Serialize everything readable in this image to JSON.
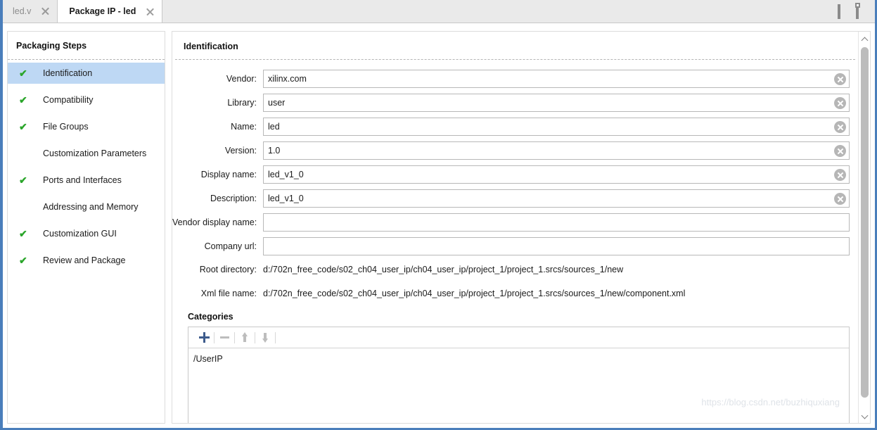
{
  "window": {
    "maximize_icon": "maximize-icon",
    "float_icon": "float-window-icon"
  },
  "tabs": [
    {
      "label": "led.v",
      "active": false
    },
    {
      "label": "Package IP - led",
      "active": true
    }
  ],
  "sidebar": {
    "title": "Packaging Steps",
    "items": [
      {
        "label": "Identification",
        "done": true,
        "selected": true
      },
      {
        "label": "Compatibility",
        "done": true,
        "selected": false
      },
      {
        "label": "File Groups",
        "done": true,
        "selected": false
      },
      {
        "label": "Customization Parameters",
        "done": false,
        "selected": false
      },
      {
        "label": "Ports and Interfaces",
        "done": true,
        "selected": false
      },
      {
        "label": "Addressing and Memory",
        "done": false,
        "selected": false
      },
      {
        "label": "Customization GUI",
        "done": true,
        "selected": false
      },
      {
        "label": "Review and Package",
        "done": true,
        "selected": false
      }
    ],
    "check_glyph": "✔"
  },
  "main": {
    "section_title": "Identification",
    "fields": [
      {
        "label": "Vendor:",
        "value": "xilinx.com",
        "placeholder": "",
        "clearable": true
      },
      {
        "label": "Library:",
        "value": "user",
        "placeholder": "",
        "clearable": true
      },
      {
        "label": "Name:",
        "value": "led",
        "placeholder": "",
        "clearable": true
      },
      {
        "label": "Version:",
        "value": "1.0",
        "placeholder": "",
        "clearable": true
      },
      {
        "label": "Display name:",
        "value": "led_v1_0",
        "placeholder": "",
        "clearable": true
      },
      {
        "label": "Description:",
        "value": "led_v1_0",
        "placeholder": "",
        "clearable": true
      },
      {
        "label": "Vendor display name:",
        "value": "",
        "placeholder": "",
        "clearable": false
      },
      {
        "label": "Company url:",
        "value": "",
        "placeholder": "",
        "clearable": false
      }
    ],
    "static_fields": [
      {
        "label": "Root directory:",
        "value": "d:/702n_free_code/s02_ch04_user_ip/ch04_user_ip/project_1/project_1.srcs/sources_1/new"
      },
      {
        "label": "Xml file name:",
        "value": "d:/702n_free_code/s02_ch04_user_ip/ch04_user_ip/project_1/project_1.srcs/sources_1/new/component.xml"
      }
    ],
    "categories": {
      "title": "Categories",
      "toolbar": [
        {
          "name": "add-category-button",
          "icon": "plus-icon",
          "enabled": true
        },
        {
          "name": "remove-category-button",
          "icon": "minus-icon",
          "enabled": false
        },
        {
          "name": "move-up-button",
          "icon": "arrow-up-icon",
          "enabled": false
        },
        {
          "name": "move-down-button",
          "icon": "arrow-down-icon",
          "enabled": false
        }
      ],
      "items": [
        "/UserIP"
      ]
    }
  },
  "watermark": "https://blog.csdn.net/buzhiquxiang",
  "colors": {
    "accent_border": "#4a7ebb",
    "selection": "#bed8f4",
    "check_green": "#2aa52a",
    "plus_blue": "#3d5b8c"
  }
}
